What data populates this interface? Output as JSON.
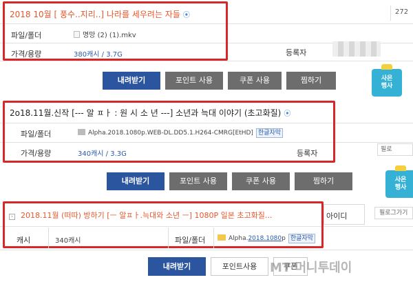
{
  "s1": {
    "title": "2018 10월 [ 풍수..지리..] 나라를 세우려는 자들",
    "side_count": "272",
    "file_label": "파일/폴더",
    "file_name": "명망 (2) (1).mkv",
    "price_label": "가격/용량",
    "price_value": "380캐시 / 3.7G",
    "reg_label": "등록자",
    "buttons": [
      "내려받기",
      "포인트 사용",
      "쿠폰 사용",
      "찜하기"
    ],
    "event": "사은\n행사"
  },
  "s2": {
    "title": "2o18.11월.신작 [--- 알 ㅍㅏ : 원 시 소 년 ---] 소년과 늑대 이야기 (초고화질)",
    "file_label": "파일/폴더",
    "file_name": "Alpha.2018.1080p.WEB-DL.DD5.1.H264-CMRG[EtHD]",
    "tag": "한글자막",
    "price_label": "가격/용량",
    "price_value": "340캐시 / 3.3G",
    "reg_label": "등록자",
    "follow": "필로",
    "buttons": [
      "내려받기",
      "포인트 사용",
      "쿠폰 사용",
      "찜하기"
    ],
    "event": "사은\n행사"
  },
  "s3": {
    "title": "2018.11월 (떠따) 방하기 [ㅡ 알ㅍㅏ.늑대와 소년 ㅡ] 1080P 일본 초고화질...",
    "side_id": "아이디",
    "follow": "필로그가기",
    "cash_label": "캐시",
    "cash_value": "340캐시",
    "file_label": "파일/폴더",
    "file_prefix": "Alpha.",
    "file_link": "2018.1080",
    "file_suffix": "p",
    "tag": "한글자막",
    "buttons": [
      "내려받기",
      "포인트사용",
      "쿠폰"
    ]
  },
  "watermark": "MT 머니투데이",
  "colors": {
    "accent": "#2c55a0",
    "highlight": "#d62828",
    "title_red": "#e4572e"
  }
}
